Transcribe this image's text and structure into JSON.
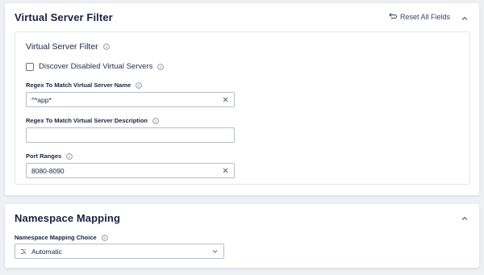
{
  "virtual_server_panel": {
    "title": "Virtual Server Filter",
    "reset_label": "Reset All Fields",
    "section_title": "Virtual Server Filter",
    "discover_disabled": {
      "label": "Discover Disabled Virtual Servers",
      "checked": false
    },
    "name_regex": {
      "label": "Regex To Match Virtual Server Name",
      "value": "^*app*"
    },
    "description_regex": {
      "label": "Regex To Match Virtual Server Description",
      "value": ""
    },
    "port_ranges": {
      "label": "Port Ranges",
      "value": "8080-8090"
    }
  },
  "namespace_panel": {
    "title": "Namespace Mapping",
    "choice_label": "Namespace Mapping Choice",
    "choice_value": "Automatic"
  },
  "icons": {
    "reset": "reset-icon",
    "collapse": "chevron-up-icon",
    "info": "info-icon",
    "clear": "close-icon",
    "route": "route-icon",
    "dropdown": "chevron-down-icon"
  },
  "colors": {
    "background": "#eef0f4",
    "panel": "#ffffff",
    "text": "#1c2142",
    "border": "#b9bdcc"
  }
}
